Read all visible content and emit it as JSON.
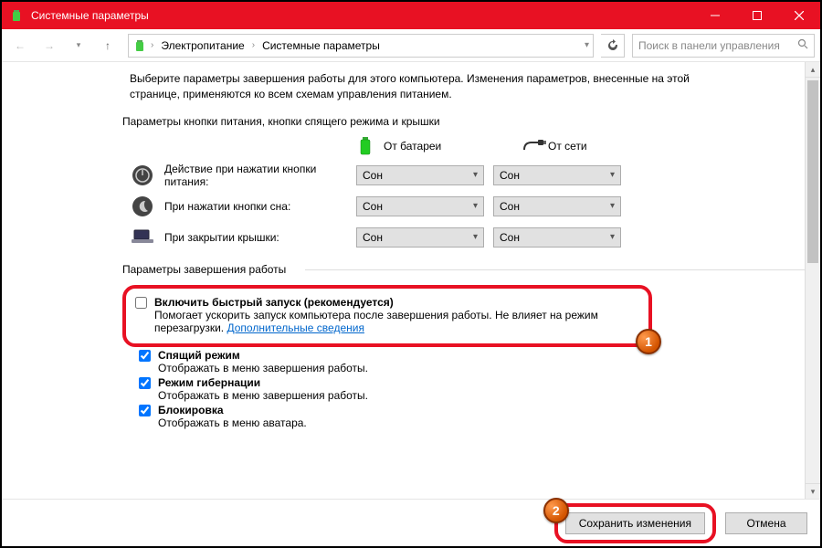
{
  "window": {
    "title": "Системные параметры"
  },
  "nav": {
    "breadcrumb": [
      "Электропитание",
      "Системные параметры"
    ],
    "search_placeholder": "Поиск в панели управления"
  },
  "intro": "Выберите параметры завершения работы для этого компьютера. Изменения параметров, внесенные на этой странице, применяются ко всем схемам управления питанием.",
  "section_buttons_title": "Параметры кнопки питания, кнопки спящего режима и крышки",
  "columns": {
    "battery": "От батареи",
    "ac": "От сети"
  },
  "rows": [
    {
      "label": "Действие при нажатии кнопки питания:",
      "battery": "Сон",
      "ac": "Сон"
    },
    {
      "label": "При нажатии кнопки сна:",
      "battery": "Сон",
      "ac": "Сон"
    },
    {
      "label": "При закрытии крышки:",
      "battery": "Сон",
      "ac": "Сон"
    }
  ],
  "shutdown_title": "Параметры завершения работы",
  "options": {
    "fast_start": {
      "checked": false,
      "title": "Включить быстрый запуск (рекомендуется)",
      "desc": "Помогает ускорить запуск компьютера после завершения работы. Не влияет на режим перезагрузки.",
      "link": "Дополнительные сведения"
    },
    "sleep": {
      "checked": true,
      "title": "Спящий режим",
      "desc": "Отображать в меню завершения работы."
    },
    "hibernate": {
      "checked": true,
      "title": "Режим гибернации",
      "desc": "Отображать в меню завершения работы."
    },
    "lock": {
      "checked": true,
      "title": "Блокировка",
      "desc": "Отображать в меню аватара."
    }
  },
  "footer": {
    "save": "Сохранить изменения",
    "cancel": "Отмена"
  },
  "markers": {
    "one": "1",
    "two": "2"
  }
}
